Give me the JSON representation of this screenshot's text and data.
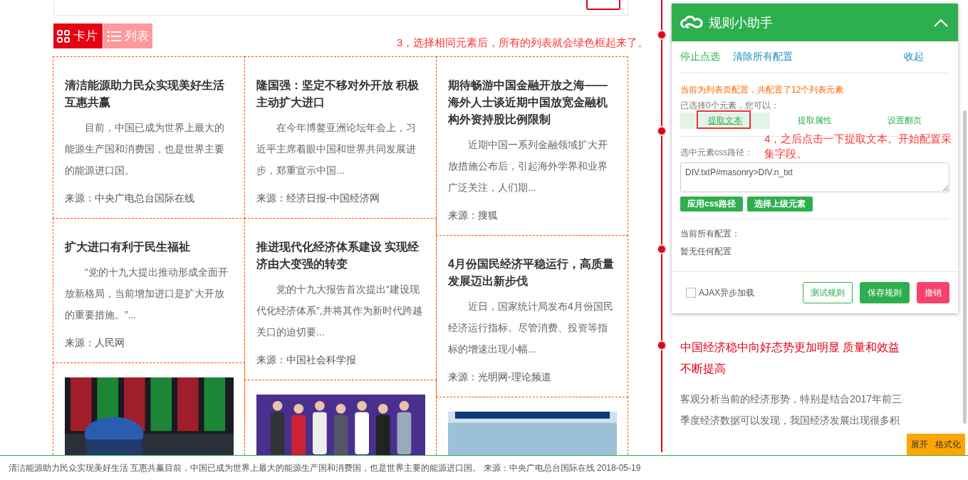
{
  "view_tabs": [
    {
      "label": "卡片",
      "kind": "grid",
      "selected": true
    },
    {
      "label": "列表",
      "kind": "list",
      "selected": false
    }
  ],
  "annotations": [
    "3，选择相同元素后，所有的列表就会绿色框起来了。",
    "4，之后点击一下提取文本。开始配置采集字段。"
  ],
  "columns": [
    [
      {
        "kind": "article",
        "title": "清洁能源助力民众实现美好生活互惠共赢",
        "summary": "目前，中国已成为世界上最大的能源生产国和消费国，也是世界主要的能源进口国。",
        "source": "来源：中央广电总台国际在线"
      },
      {
        "kind": "article",
        "title": "扩大进口有利于民生福祉",
        "summary": "“党的十九大提出推动形成全面开放新格局，当前增加进口是扩大开放的重要措施。”...",
        "source": "来源：人民网"
      },
      {
        "kind": "picture"
      }
    ],
    [
      {
        "kind": "article",
        "title": "隆国强：坚定不移对外开放 积极主动扩大进口",
        "summary": "在今年博鳌亚洲论坛年会上，习近平主席着眼中国和世界共同发展进步，郑重宣示中国...",
        "source": "来源：经济日报-中国经济网"
      },
      {
        "kind": "article",
        "title": "推进现代化经济体系建设 实现经济由大变强的转变",
        "summary": "党的十九大报告首次提出“建设现代化经济体系”,并将其作为新时代跨越关口的迫切要...",
        "source": "来源：中国社会科学报"
      },
      {
        "kind": "picture"
      }
    ],
    [
      {
        "kind": "article",
        "title": "期待畅游中国金融开放之海——海外人士谈近期中国放宽金融机构外资持股比例限制",
        "summary": "近期中国一系列金融领域扩大开放措施公布后，引起海外学界和业界广泛关注，人们期...",
        "source": "来源：搜狐"
      },
      {
        "kind": "article",
        "title": "4月份国民经济平稳运行，高质量发展迈出新步伐",
        "summary": "近日，国家统计局发布4月份国民经济运行指标。尽管消费、投资等指标的增速出现小幅...",
        "source": "来源：光明网-理论频道"
      },
      {
        "kind": "picture"
      }
    ]
  ],
  "panel": {
    "title": "规则小助手",
    "expanded": true,
    "links": [
      {
        "label": "停止点选",
        "kind": "stop"
      },
      {
        "label": "清除所有配置",
        "kind": "clear"
      },
      {
        "label": "收起",
        "kind": "collapse"
      }
    ],
    "notice": "当前为列表页配置，共配置了12个列表元素",
    "selection_hint": "已选择0个元素，您可以：",
    "actions": [
      {
        "label": "提取文本",
        "selected": true,
        "highlighted": true
      },
      {
        "label": "提取属性",
        "selected": false,
        "highlighted": false
      },
      {
        "label": "设置翻页",
        "selected": false,
        "highlighted": false
      }
    ],
    "css_path_label": "选中元素css路径：",
    "css_path": "DIV.txtP#masonry>DIV.n_txt",
    "path_buttons": [
      "应用css路径",
      "选择上级元素"
    ],
    "configs_label": "当前所有配置：",
    "configs_empty": "暂无任何配置",
    "ajax": {
      "label": "AJAX异步加载",
      "checked": false
    },
    "footer_buttons": [
      {
        "label": "测试规则",
        "kind": "outline"
      },
      {
        "label": "保存规则",
        "kind": "primary"
      },
      {
        "label": "撤销",
        "kind": "danger"
      }
    ]
  },
  "timeline_item": {
    "title": "中国经济稳中向好态势更加明显 质量和效益不断提高",
    "summary": "客观分析当前的经济形势，特别是结合2017年前三季度经济数据可以发现，我国经济发展出现很多积"
  },
  "corner_buttons": [
    "展开",
    "格式化"
  ],
  "status_bar": "清洁能源助力民众实现美好生活 互惠共赢目前，中国已成为世界上最大的能源生产国和消费国，也是世界主要的能源进口国。 来源：中央广电总台国际在线 2018-05-19"
}
